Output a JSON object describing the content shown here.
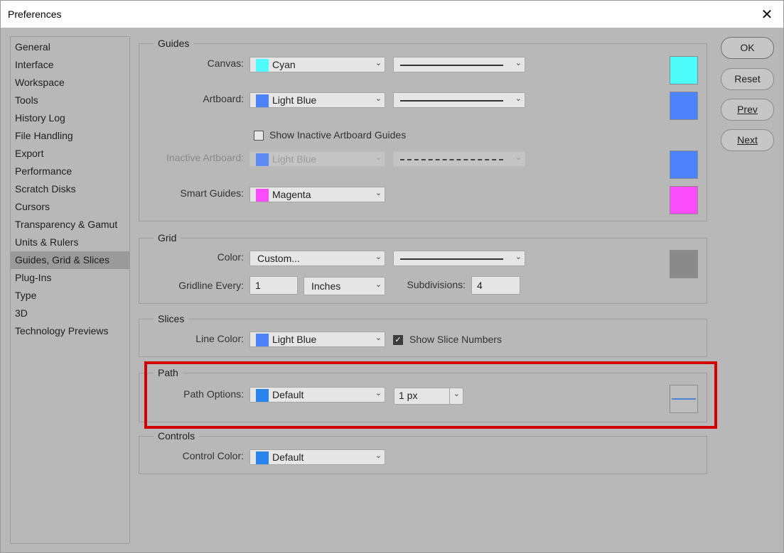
{
  "window": {
    "title": "Preferences"
  },
  "sidebar": {
    "items": [
      {
        "label": "General"
      },
      {
        "label": "Interface"
      },
      {
        "label": "Workspace"
      },
      {
        "label": "Tools"
      },
      {
        "label": "History Log"
      },
      {
        "label": "File Handling"
      },
      {
        "label": "Export"
      },
      {
        "label": "Performance"
      },
      {
        "label": "Scratch Disks"
      },
      {
        "label": "Cursors"
      },
      {
        "label": "Transparency & Gamut"
      },
      {
        "label": "Units & Rulers"
      },
      {
        "label": "Guides, Grid & Slices",
        "selected": true
      },
      {
        "label": "Plug-Ins"
      },
      {
        "label": "Type"
      },
      {
        "label": "3D"
      },
      {
        "label": "Technology Previews"
      }
    ]
  },
  "guides": {
    "title": "Guides",
    "canvas": {
      "label": "Canvas:",
      "color_name": "Cyan",
      "swatch": "#4dfcfb"
    },
    "artboard": {
      "label": "Artboard:",
      "color_name": "Light Blue",
      "swatch": "#4c82fb"
    },
    "show_inactive_label": "Show Inactive Artboard Guides",
    "show_inactive_checked": false,
    "inactive_artboard": {
      "label": "Inactive Artboard:",
      "color_name": "Light Blue",
      "swatch": "#4c82fb"
    },
    "smart_guides": {
      "label": "Smart Guides:",
      "color_name": "Magenta",
      "swatch": "#fb4cfb"
    }
  },
  "grid": {
    "title": "Grid",
    "color_label": "Color:",
    "color_value": "Custom...",
    "preview_color": "#8a8a8a",
    "gridline_label": "Gridline Every:",
    "gridline_value": "1",
    "units_value": "Inches",
    "subdivisions_label": "Subdivisions:",
    "subdivisions_value": "4"
  },
  "slices": {
    "title": "Slices",
    "line_color_label": "Line Color:",
    "line_color_value": "Light Blue",
    "swatch": "#4c82fb",
    "show_numbers_label": "Show Slice Numbers",
    "show_numbers_checked": true
  },
  "path": {
    "title": "Path",
    "options_label": "Path Options:",
    "color_value": "Default",
    "swatch": "#2a84f0",
    "width_value": "1 px"
  },
  "controls": {
    "title": "Controls",
    "color_label": "Control Color:",
    "color_value": "Default",
    "swatch": "#2a84f0"
  },
  "buttons": {
    "ok": "OK",
    "reset": "Reset",
    "prev": "Prev",
    "next": "Next"
  },
  "icons": {
    "close": "close-icon",
    "dropdown": "chevron-down-icon",
    "check": "checkmark-icon"
  }
}
